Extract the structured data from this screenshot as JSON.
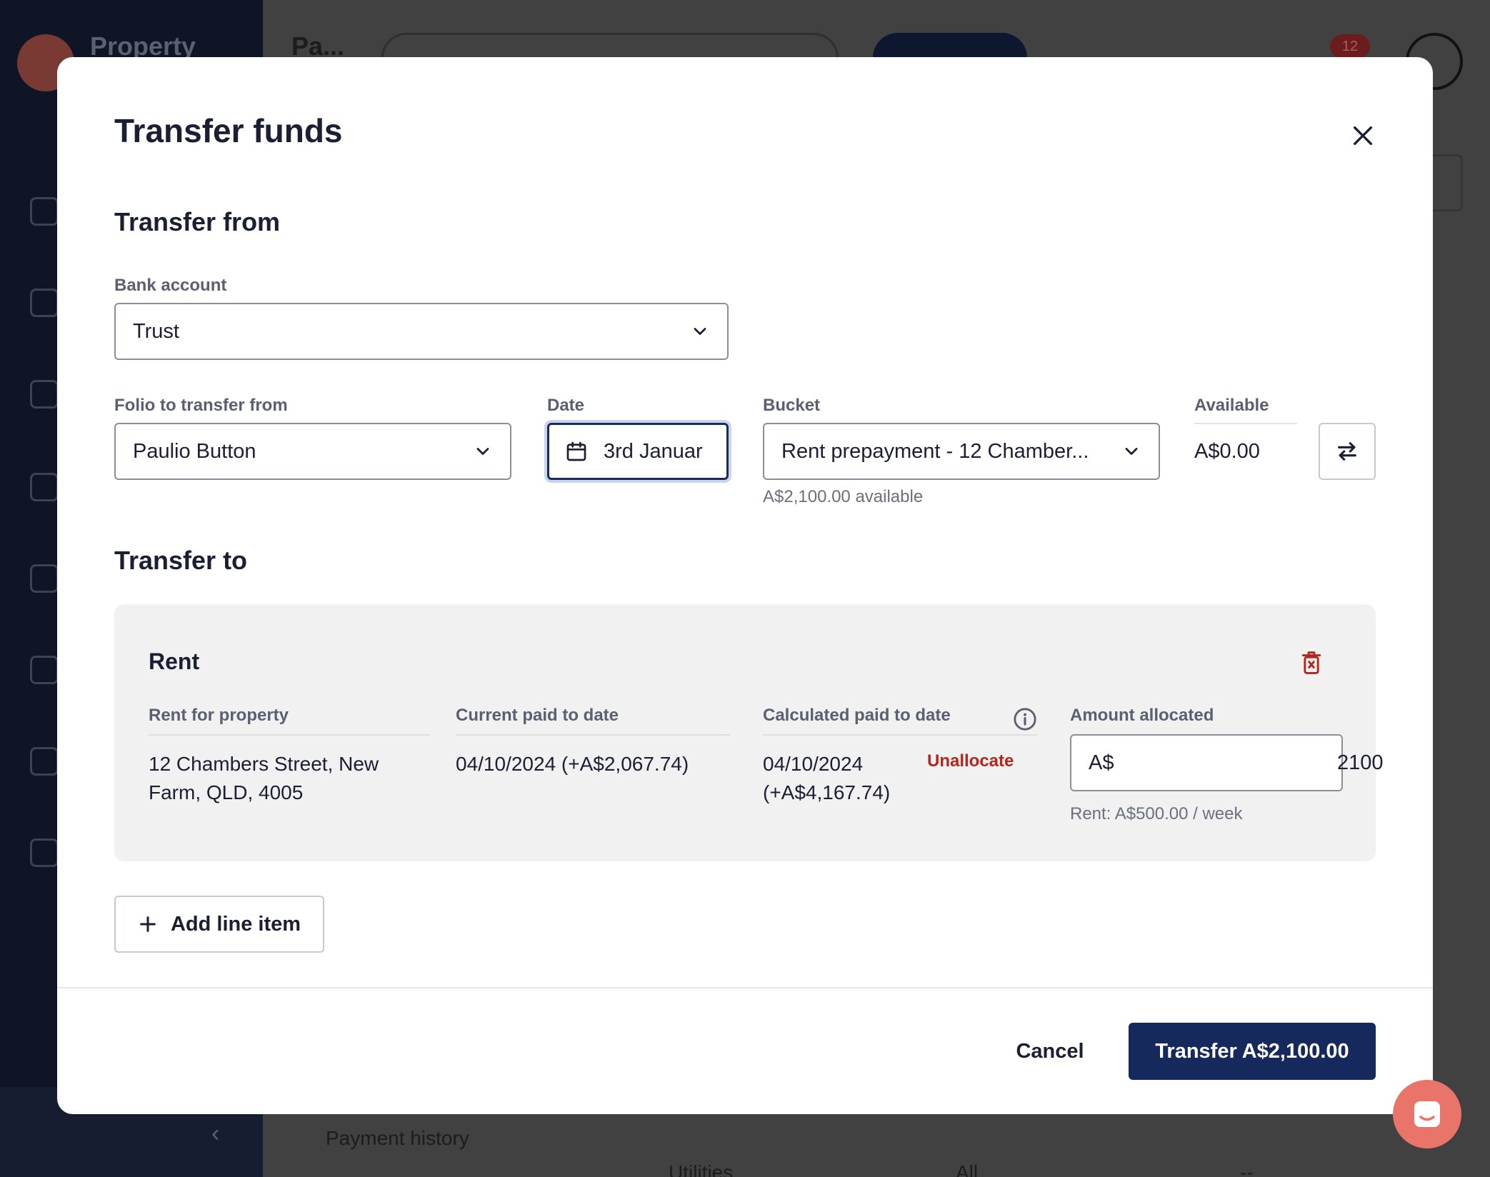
{
  "background": {
    "brand": "Property",
    "page_title": "Pa...",
    "notification_count": "12",
    "payment_history": "Payment history",
    "row_category": "Utilities",
    "row_filter": "All",
    "row_value": "--"
  },
  "modal": {
    "title": "Transfer funds",
    "transfer_from": {
      "heading": "Transfer from",
      "bank_account_label": "Bank account",
      "bank_account_value": "Trust",
      "folio_label": "Folio to transfer from",
      "folio_value": "Paulio Button",
      "date_label": "Date",
      "date_value": "3rd Januar",
      "bucket_label": "Bucket",
      "bucket_value": "Rent prepayment - 12 Chamber...",
      "bucket_available": "A$2,100.00 available",
      "available_label": "Available",
      "available_value": "A$0.00"
    },
    "transfer_to": {
      "heading": "Transfer to",
      "line_item": {
        "title": "Rent",
        "columns": {
          "property_label": "Rent for property",
          "property_value": "12 Chambers Street, New Farm, QLD, 4005",
          "current_label": "Current paid to date",
          "current_value": "04/10/2024 (+A$2,067.74)",
          "calculated_label": "Calculated paid to date",
          "calculated_value": "04/10/2024 (+A$4,167.74)",
          "unallocate": "Unallocate",
          "amount_label": "Amount allocated",
          "amount_prefix": "A$",
          "amount_value": "2100",
          "rent_note": "Rent: A$500.00 / week"
        }
      }
    },
    "add_line_item": "Add line item",
    "cancel": "Cancel",
    "submit": "Transfer A$2,100.00"
  },
  "colors": {
    "primary": "#16295c",
    "danger": "#b3261e",
    "chat": "#e8746a"
  },
  "icons": [
    "close-icon",
    "chevron-down-icon",
    "calendar-icon",
    "swap-icon",
    "trash-icon",
    "info-icon",
    "plus-icon",
    "chat-icon"
  ]
}
